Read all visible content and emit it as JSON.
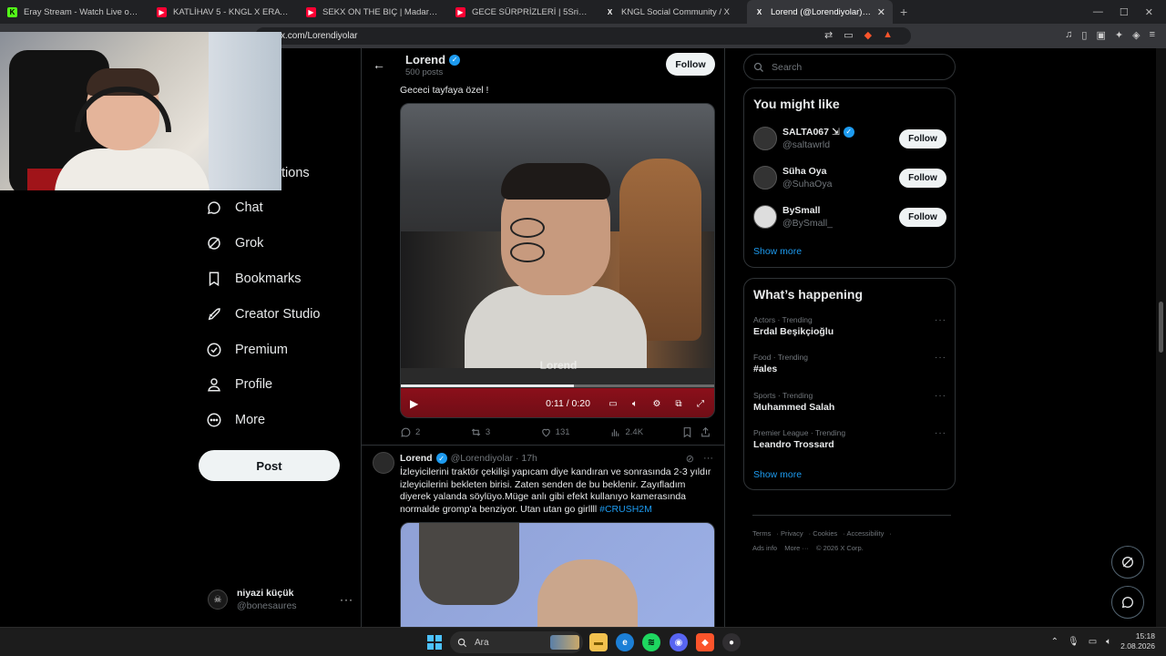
{
  "browser": {
    "tabs": [
      {
        "title": "Eray Stream - Watch Live on Kick",
        "fav_color": "#53fc18",
        "fav_text": "K"
      },
      {
        "title": "KATLİHAV 5 - KNGL X ERAY067 & M",
        "fav_color": "#ff0033",
        "fav_text": "▶"
      },
      {
        "title": "SEKX ON THE BIÇ | Madara Olduk #7",
        "fav_color": "#ff0033",
        "fav_text": "▶"
      },
      {
        "title": "GECE SÜRPRİZLERİ | 5Sriders | Motor",
        "fav_color": "#ff0033",
        "fav_text": "▶"
      },
      {
        "title": "KNGL Social Community / X",
        "fav_color": "#ffffff",
        "fav_text": "X"
      },
      {
        "title": "Lorend (@Lorendiyolar) / X",
        "fav_color": "#ffffff",
        "fav_text": "X"
      }
    ],
    "new_tab": "+",
    "url": "x.com/Lorendiyolar"
  },
  "nav": {
    "partial_label": "tions",
    "items": [
      {
        "label": "Chat",
        "icon": "chat-icon"
      },
      {
        "label": "Grok",
        "icon": "grok-icon"
      },
      {
        "label": "Bookmarks",
        "icon": "bookmark-icon"
      },
      {
        "label": "Creator Studio",
        "icon": "rocket-icon"
      },
      {
        "label": "Premium",
        "icon": "premium-icon"
      },
      {
        "label": "Profile",
        "icon": "profile-icon"
      },
      {
        "label": "More",
        "icon": "more-icon"
      }
    ],
    "post_label": "Post",
    "account": {
      "name": "niyazi küçük",
      "handle": "@bonesaures"
    }
  },
  "profile_header": {
    "name": "Lorend",
    "posts": "500 posts",
    "follow_label": "Follow"
  },
  "tweet1": {
    "text": "Gececi tayfaya özel !",
    "video": {
      "time": "0:11 / 0:20",
      "progress": 0.55,
      "watermark": "Lorend"
    },
    "actions": {
      "replies": "2",
      "reposts": "3",
      "likes": "131",
      "views": "2.4K"
    }
  },
  "tweet2": {
    "name": "Lorend",
    "handle": "@Lorendiyolar · 17h",
    "body": "İzleyicilerini traktör çekilişi yapıcam diye kandıran ve sonrasında 2-3 yıldır izleyicilerini bekleten birisi. Zaten senden de bu beklenir. Zayıfladım diyerek yalanda söylüyo.Müge anlı gibi efekt kullanıyo kamerasında normalde gromp'a benziyor. Utan utan go girllll ",
    "hashtag": "#CRUSH2M"
  },
  "right": {
    "search_placeholder": "Search",
    "wtf_title": "You might like",
    "suggestions": [
      {
        "name": "SALTA067 ⇲",
        "handle": "@saltawrld",
        "verified": true,
        "follow": "Follow"
      },
      {
        "name": "Süha Oya",
        "handle": "@SuhaOya",
        "verified": false,
        "follow": "Follow"
      },
      {
        "name": "BySmall",
        "handle": "@BySmall_",
        "verified": false,
        "follow": "Follow"
      }
    ],
    "show_more": "Show more",
    "happening_title": "What’s happening",
    "trends": [
      {
        "category": "Actors · Trending",
        "name": "Erdal Beşikçioğlu"
      },
      {
        "category": "Food · Trending",
        "name": "#ales"
      },
      {
        "category": "Sports · Trending",
        "name": "Muhammed Salah"
      },
      {
        "category": "Premier League · Trending",
        "name": "Leandro Trossard"
      }
    ],
    "show_more2": "Show more",
    "footer": [
      "Terms",
      "Privacy",
      "Cookies",
      "Accessibility",
      "Ads info",
      "More ···",
      "© 2026 X Corp."
    ]
  },
  "taskbar": {
    "search": "Ara",
    "time": "15:18",
    "date": "2.08.2026"
  }
}
